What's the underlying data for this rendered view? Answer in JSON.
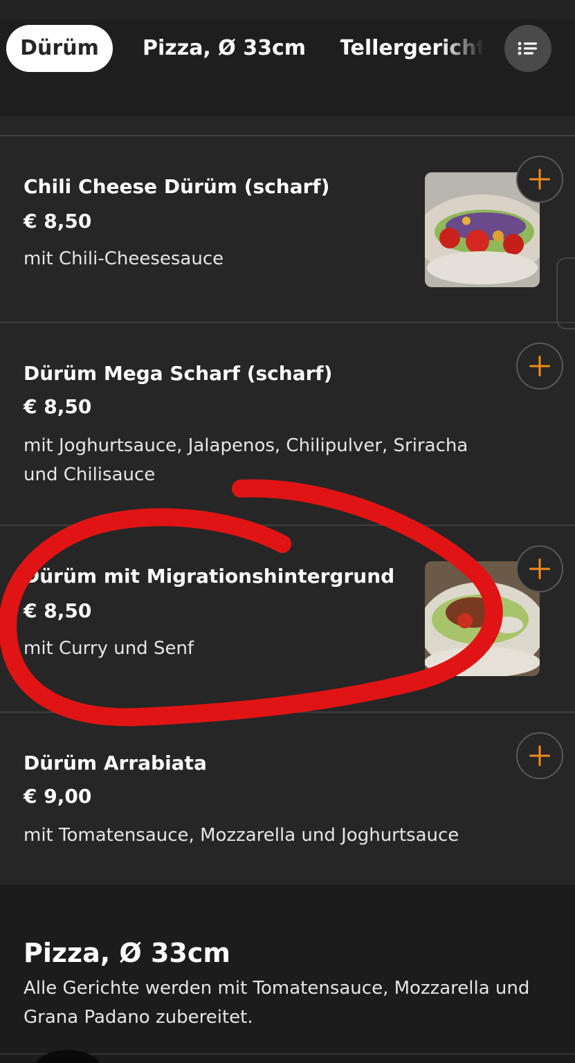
{
  "categories": {
    "tabs": [
      {
        "label": "Dürüm",
        "active": true
      },
      {
        "label": "Pizza, Ø 33cm",
        "active": false
      },
      {
        "label": "Tellergerichte",
        "active": false
      }
    ],
    "menu_icon": "list-icon"
  },
  "items": [
    {
      "name": "Chili Cheese Dürüm (scharf)",
      "price": "€ 8,50",
      "description": "mit Chili-Cheesesauce",
      "has_image": true
    },
    {
      "name": "Dürüm Mega Scharf (scharf)",
      "price": "€ 8,50",
      "description": "mit Joghurtsauce, Jalapenos, Chilipulver, Sriracha und Chilisauce",
      "has_image": false
    },
    {
      "name": "Dürüm mit Migrationshintergrund",
      "price": "€ 8,50",
      "description": "mit Curry und Senf",
      "has_image": true
    },
    {
      "name": "Dürüm Arrabiata",
      "price": "€ 9,00",
      "description": "mit Tomatensauce, Mozzarella und Joghurtsauce",
      "has_image": false
    }
  ],
  "add_icon": "plus-icon",
  "section": {
    "title": "Pizza, Ø 33cm",
    "description": "Alle Gerichte werden mit Tomatensauce, Mozzarella und Grana Padano zubereitet."
  },
  "colors": {
    "accent": "#f28c1c",
    "background": "#262626",
    "annotation": "#e01414"
  }
}
